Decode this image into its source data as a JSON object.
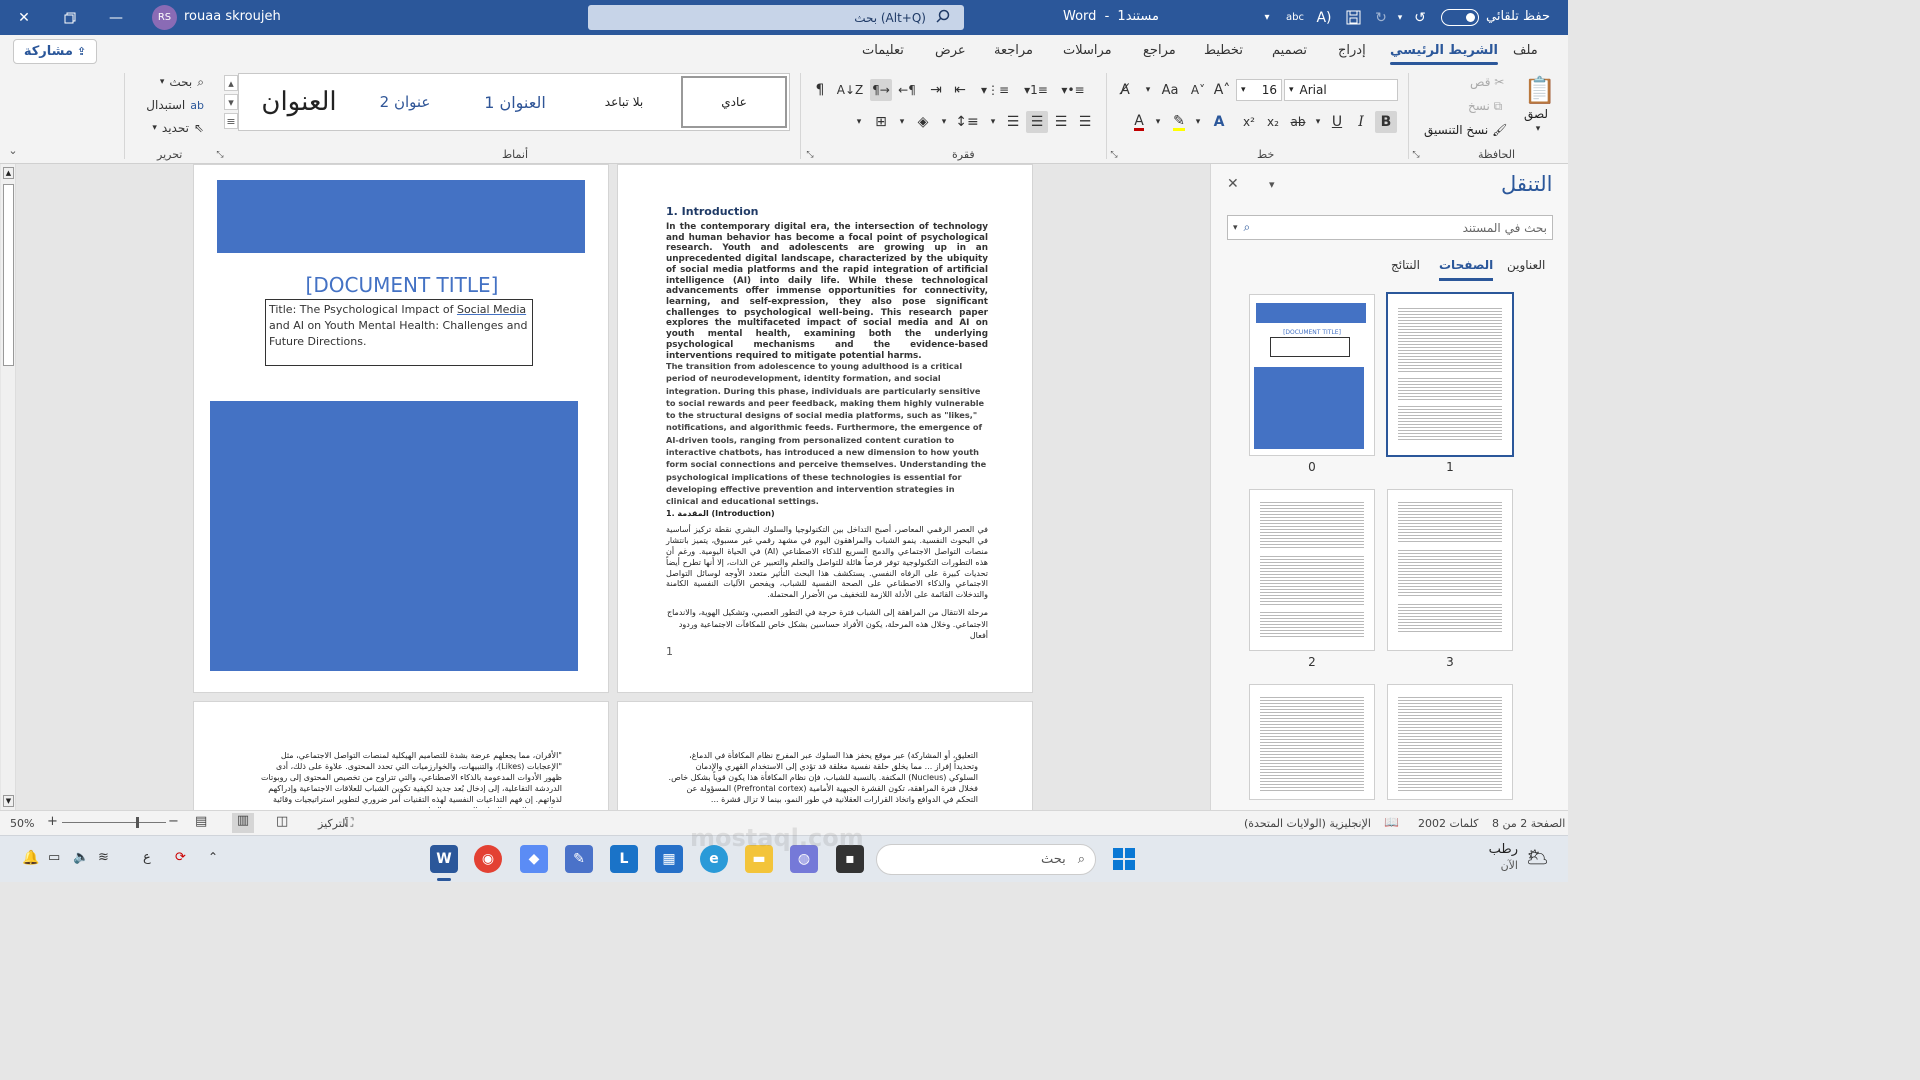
{
  "titlebar": {
    "user_name": "rouaa skroujeh",
    "user_initials": "RS",
    "search_placeholder": "بحث (Alt+Q)",
    "doc_title": "مستند1",
    "app_name": "Word",
    "autosave_label": "حفظ تلقائي",
    "dash": "-"
  },
  "tabs": [
    "ملف",
    "الشريط الرئيسي",
    "إدراج",
    "تصميم",
    "تخطيط",
    "مراجع",
    "مراسلات",
    "مراجعة",
    "عرض",
    "تعليمات"
  ],
  "active_tab": "الشريط الرئيسي",
  "share_label": "مشاركة",
  "ribbon": {
    "clipboard": {
      "label": "الحافظة",
      "paste": "لصق",
      "cut": "قص",
      "copy": "نسخ",
      "format_painter": "نسخ التنسيق"
    },
    "font": {
      "label": "خط",
      "name": "Arial",
      "size": "16"
    },
    "paragraph": {
      "label": "فقرة"
    },
    "styles": {
      "label": "أنماط",
      "items": [
        "عادي",
        "بلا تباعد",
        "العنوان 1",
        "عنوان 2",
        "العنوان"
      ]
    },
    "editing": {
      "label": "تحرير",
      "find": "بحث",
      "replace": "استبدال",
      "select": "تحديد"
    }
  },
  "nav": {
    "title": "التنقل",
    "search_placeholder": "بحث في المستند",
    "tabs": [
      "العناوين",
      "الصفحات",
      "النتائج"
    ],
    "active_tab": "الصفحات",
    "page_numbers": [
      "0",
      "1",
      "2",
      "3"
    ]
  },
  "page_left": {
    "doc_title_placeholder": "[DOCUMENT TITLE]",
    "title_text_prefix": "Title: The Psychological Impact of ",
    "title_text_link": "Social Media",
    "title_text_suffix": " and AI on Youth Mental Health: Challenges and Future Directions."
  },
  "page_right": {
    "heading": "1. Introduction",
    "para1": "In the contemporary digital era, the intersection of technology and human behavior has become a focal point of psychological research. Youth and adolescents are growing up in an unprecedented digital landscape, characterized by the ubiquity of social media platforms and the rapid integration of artificial intelligence (AI) into daily life. While these technological advancements offer immense opportunities for connectivity, learning, and self-expression, they also pose significant challenges to psychological well-being. This research paper explores the multifaceted impact of social media and AI on youth mental health, examining both the underlying psychological mechanisms and the evidence-based interventions required to mitigate potential harms.",
    "para2": "The transition from adolescence to young adulthood is a critical period of neurodevelopment, identity formation, and social integration. During this phase, individuals are particularly sensitive to social rewards and peer feedback, making them highly vulnerable to the structural designs of social media platforms, such as \"likes,\" notifications, and algorithmic feeds. Furthermore, the emergence of AI-driven tools, ranging from personalized content curation to interactive chatbots, has introduced a new dimension to how youth form social connections and perceive themselves. Understanding the psychological implications of these technologies is essential for developing effective prevention and intervention strategies in clinical and educational settings.",
    "ar_heading": "1. المقدمة (Introduction)",
    "ar_para1": "في العصر الرقمي المعاصر، أصبح التداخل بين التكنولوجيا والسلوك البشري نقطة تركيز أساسية في البحوث النفسية. ينمو الشباب والمراهقون اليوم في مشهد رقمي غير مسبوق، يتميز بانتشار منصات التواصل الاجتماعي والدمج السريع للذكاء الاصطناعي (AI) في الحياة اليومية. ورغم أن هذه التطورات التكنولوجية توفر فرصاً هائلة للتواصل والتعلم والتعبير عن الذات، إلا أنها تطرح أيضاً تحديات كبيرة على الرفاه النفسي. يستكشف هذا البحث التأثير متعدد الأوجه لوسائل التواصل الاجتماعي والذكاء الاصطناعي على الصحة النفسية للشباب، ويفحص الآليات النفسية الكامنة والتدخلات القائمة على الأدلة اللازمة للتخفيف من الأضرار المحتملة.",
    "ar_para2": "مرحلة الانتقال من المراهقة إلى الشباب فترة حرجة في التطور العصبي، وتشكيل الهوية، والاندماج الاجتماعي. وخلال هذه المرحلة، يكون الأفراد حساسين بشكل خاص للمكافآت الاجتماعية وردود أفعال",
    "page_number": "1"
  },
  "page_bottom_left": {
    "text": "\"الأقران، مما يجعلهم عرضة بشدة للتصاميم الهيكلية لمنصات التواصل الاجتماعي، مثل \"الإعجابات (Likes)، والتنبيهات، والخوارزميات التي تحدد المحتوى. علاوة على ذلك، أدى ظهور الأدوات المدعومة بالذكاء الاصطناعي، والتي تتراوح من تخصيص المحتوى إلى روبوتات الدردشة التفاعلية، إلى إدخال بُعد جديد لكيفية تكوين الشباب للعلاقات الاجتماعية وإدراكهم لذواتهم. إن فهم التداعيات النفسية لهذه التقنيات أمر ضروري لتطوير استراتيجيات وقائية وعلاجية فعالة في البيئات السريرية والتعليمية."
  },
  "page_bottom_right": {
    "text": "التعليق، أو المشاركة) عبر موقع يحفز هذا السلوك عبر المفرج نظام المكافأة في الدماغ، وتحديداً إفراز ... مما يخلق حلقة نفسية مغلقة قد تؤدي إلى الاستخدام القهري والإدمان السلوكي (Nucleus) المكتفة. بالنسبة للشباب، فإن نظام المكافأة هذا يكون قوياً بشكل خاص. فخلال فترة المراهقة، تكون القشرة الجبهية الأمامية (Prefrontal cortex) المسؤولة عن التحكم في الدوافع واتخاذ القرارات العقلانية في طور النمو، بينما لا تزال قشرة ..."
  },
  "status": {
    "page": "الصفحة 2 من 8",
    "words": "2002 كلمات",
    "language": "الإنجليزية (الولايات المتحدة)",
    "focus": "التركيز",
    "zoom": "50%"
  },
  "taskbar": {
    "weather": "رطب",
    "weather_sub": "الآن",
    "search": "بحث",
    "lang": "ع"
  },
  "watermark": "mostaql.com"
}
